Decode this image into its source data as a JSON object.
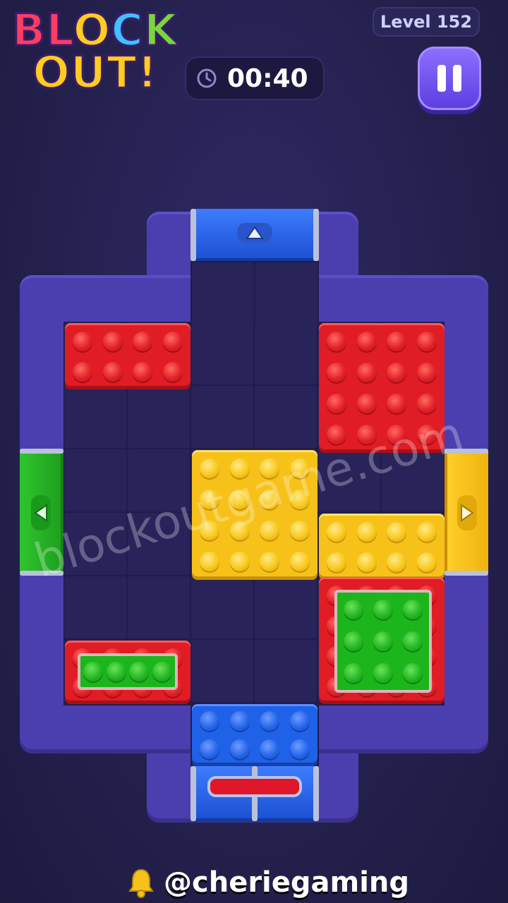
{
  "header": {
    "logo_line1": "BLOCK",
    "logo_line2": "OUT!",
    "level_label": "Level 152",
    "timer": "00:40",
    "timer_icon": "clock-icon",
    "pause_icon": "pause-icon"
  },
  "board": {
    "blocks": [
      {
        "name": "red-block-top-left",
        "color": "red",
        "studs": "4x2"
      },
      {
        "name": "red-block-top-right",
        "color": "red",
        "studs": "4x4"
      },
      {
        "name": "yellow-block-center",
        "color": "yellow",
        "studs": "4x4"
      },
      {
        "name": "yellow-block-right",
        "color": "yellow",
        "studs": "4x2"
      },
      {
        "name": "red-green-block-right",
        "color": "red",
        "inner_color": "green",
        "studs": "4x4"
      },
      {
        "name": "red-green-block-bottom-left",
        "color": "red",
        "inner_color": "green",
        "studs": "4x2"
      },
      {
        "name": "blue-block-bottom",
        "color": "blue",
        "studs": "4x2"
      }
    ],
    "gates": [
      {
        "name": "blue-gate-top",
        "color": "blue",
        "arrow": "up"
      },
      {
        "name": "green-gate-left",
        "color": "green",
        "arrow": "left"
      },
      {
        "name": "yellow-gate-right",
        "color": "yellow",
        "arrow": "right"
      },
      {
        "name": "blue-gate-bottom",
        "color": "blue",
        "marker": "red"
      }
    ]
  },
  "watermark": "blockoutgame.com",
  "footer": {
    "handle": "@cheriegaming",
    "icon": "bell-icon"
  },
  "colors": {
    "background": "#25214f",
    "frame": "#4b3fb0",
    "red": "#e01c25",
    "yellow": "#f6c21a",
    "blue": "#1f62e8",
    "green": "#1cb51c"
  }
}
